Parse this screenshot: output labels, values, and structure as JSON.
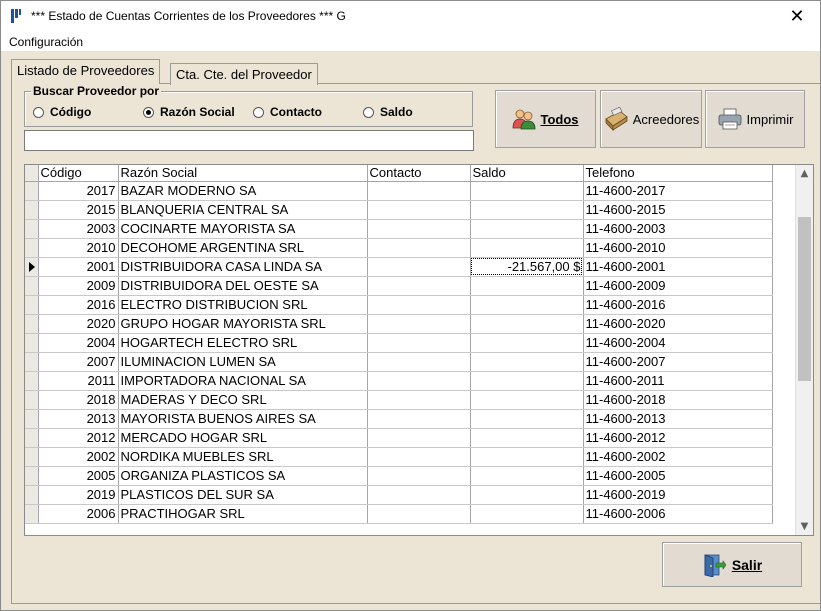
{
  "window": {
    "title": "*** Estado de Cuentas Corrientes de los Proveedores *** G",
    "close_glyph": "✕"
  },
  "menu": {
    "items": [
      "Configuración"
    ]
  },
  "tabs": [
    {
      "label": "Listado de Proveedores",
      "active": true
    },
    {
      "label": "Cta. Cte. del Proveedor",
      "active": false
    }
  ],
  "search": {
    "group_label": "Buscar Proveedor por",
    "options": [
      "Código",
      "Razón Social",
      "Contacto",
      "Saldo"
    ],
    "selected": "Razón Social",
    "value": ""
  },
  "buttons": {
    "todos": "Todos",
    "acreedores": "Acreedores",
    "imprimir": "Imprimir",
    "salir": "Salir"
  },
  "icons": {
    "todos": "users-icon",
    "acreedores": "cash-register-icon",
    "imprimir": "printer-icon",
    "salir": "exit-door-icon"
  },
  "grid": {
    "columns": [
      "Código",
      "Razón Social",
      "Contacto",
      "Saldo",
      "Telefono"
    ],
    "current_row": 4,
    "rows": [
      {
        "codigo": "2017",
        "razon": "BAZAR MODERNO SA",
        "contacto": "",
        "saldo": "",
        "telefono": "11-4600-2017"
      },
      {
        "codigo": "2015",
        "razon": "BLANQUERIA CENTRAL SA",
        "contacto": "",
        "saldo": "",
        "telefono": "11-4600-2015"
      },
      {
        "codigo": "2003",
        "razon": "COCINARTE MAYORISTA SA",
        "contacto": "",
        "saldo": "",
        "telefono": "11-4600-2003"
      },
      {
        "codigo": "2010",
        "razon": "DECOHOME ARGENTINA SRL",
        "contacto": "",
        "saldo": "",
        "telefono": "11-4600-2010"
      },
      {
        "codigo": "2001",
        "razon": "DISTRIBUIDORA CASA LINDA SA",
        "contacto": "",
        "saldo": "-21.567,00 $",
        "telefono": "11-4600-2001"
      },
      {
        "codigo": "2009",
        "razon": "DISTRIBUIDORA DEL OESTE SA",
        "contacto": "",
        "saldo": "",
        "telefono": "11-4600-2009"
      },
      {
        "codigo": "2016",
        "razon": "ELECTRO DISTRIBUCION SRL",
        "contacto": "",
        "saldo": "",
        "telefono": "11-4600-2016"
      },
      {
        "codigo": "2020",
        "razon": "GRUPO HOGAR MAYORISTA SRL",
        "contacto": "",
        "saldo": "",
        "telefono": "11-4600-2020"
      },
      {
        "codigo": "2004",
        "razon": "HOGARTECH ELECTRO SRL",
        "contacto": "",
        "saldo": "",
        "telefono": "11-4600-2004"
      },
      {
        "codigo": "2007",
        "razon": "ILUMINACION LUMEN SA",
        "contacto": "",
        "saldo": "",
        "telefono": "11-4600-2007"
      },
      {
        "codigo": "2011",
        "razon": "IMPORTADORA NACIONAL SA",
        "contacto": "",
        "saldo": "",
        "telefono": "11-4600-2011"
      },
      {
        "codigo": "2018",
        "razon": "MADERAS Y DECO SRL",
        "contacto": "",
        "saldo": "",
        "telefono": "11-4600-2018"
      },
      {
        "codigo": "2013",
        "razon": "MAYORISTA BUENOS AIRES SA",
        "contacto": "",
        "saldo": "",
        "telefono": "11-4600-2013"
      },
      {
        "codigo": "2012",
        "razon": "MERCADO HOGAR SRL",
        "contacto": "",
        "saldo": "",
        "telefono": "11-4600-2012"
      },
      {
        "codigo": "2002",
        "razon": "NORDIKA MUEBLES SRL",
        "contacto": "",
        "saldo": "",
        "telefono": "11-4600-2002"
      },
      {
        "codigo": "2005",
        "razon": "ORGANIZA PLASTICOS SA",
        "contacto": "",
        "saldo": "",
        "telefono": "11-4600-2005"
      },
      {
        "codigo": "2019",
        "razon": "PLASTICOS DEL SUR SA",
        "contacto": "",
        "saldo": "",
        "telefono": "11-4600-2019"
      },
      {
        "codigo": "2006",
        "razon": "PRACTIHOGAR SRL",
        "contacto": "",
        "saldo": "",
        "telefono": "11-4600-2006"
      }
    ]
  },
  "colors": {
    "client_bg": "#ece4d5",
    "button_bg": "#e1dbd2",
    "grid_line": "#a6a6a6"
  }
}
